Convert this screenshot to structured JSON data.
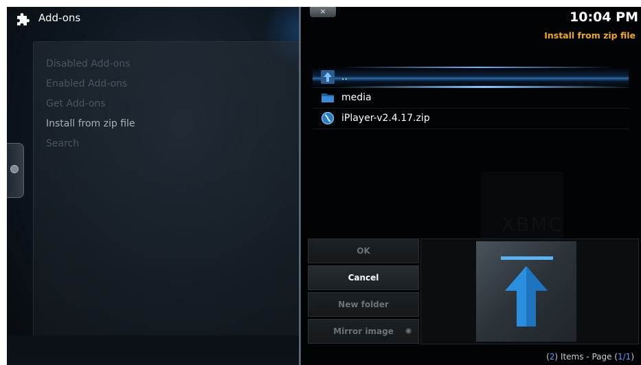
{
  "app": {
    "section_title": "Add-ons",
    "clock": "10:04 PM",
    "dialog_title": "Install from zip file",
    "close_symbol": "×"
  },
  "left_menu": {
    "items": [
      {
        "label": "Disabled Add-ons",
        "active": false
      },
      {
        "label": "Enabled Add-ons",
        "active": false
      },
      {
        "label": "Get Add-ons",
        "active": false
      },
      {
        "label": "Install from zip file",
        "active": true
      },
      {
        "label": "Search",
        "active": false
      }
    ]
  },
  "file_list": {
    "rows": [
      {
        "label": "..",
        "icon": "up-arrow-icon",
        "selected": true
      },
      {
        "label": "media",
        "icon": "folder-icon",
        "selected": false
      },
      {
        "label": "iPlayer-v2.4.17.zip",
        "icon": "zip-file-icon",
        "selected": false
      }
    ]
  },
  "buttons": {
    "ok": "OK",
    "cancel": "Cancel",
    "new_folder": "New folder",
    "mirror_image": "Mirror image"
  },
  "footer": {
    "open_paren": "(",
    "items_count": "2",
    "items_text": ") Items - Page (",
    "page": "1/1",
    "close_paren": ")"
  },
  "watermark": "XBMC",
  "colors": {
    "accent_orange": "#f0a818",
    "highlight_blue": "#4c9cff",
    "background": "#05070a"
  }
}
